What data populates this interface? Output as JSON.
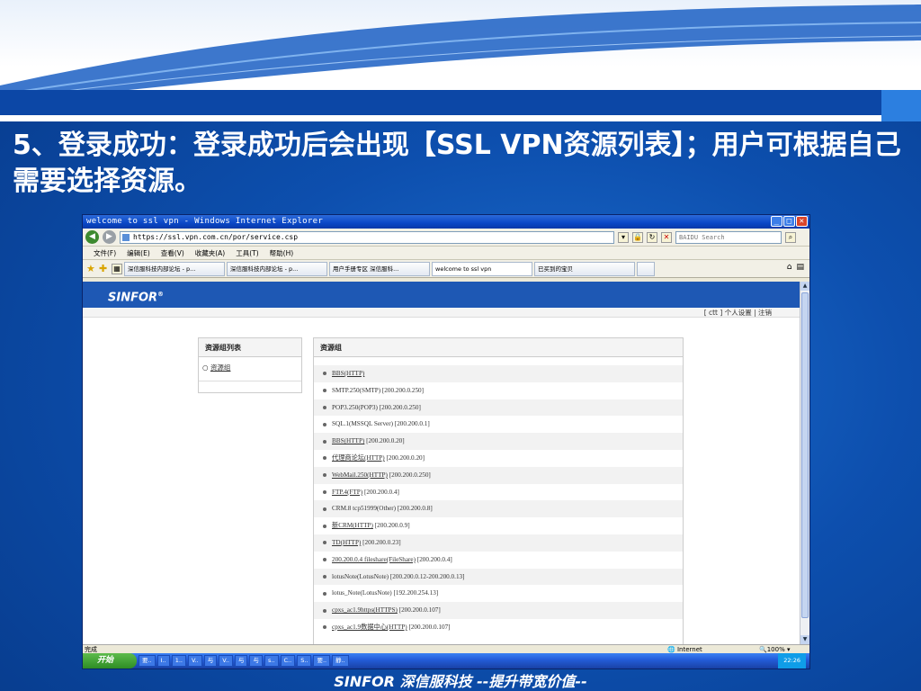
{
  "slide": {
    "title": "5、登录成功：登录成功后会出现【SSL VPN资源列表】；用户可根据自己需要选择资源。",
    "footer": "SINFOR 深信服科技  --提升带宽价值--"
  },
  "window": {
    "title": "welcome to ssl vpn - Windows Internet Explorer",
    "address": "https://ssl.vpn.com.cn/por/service.csp",
    "search_placeholder": "BAIDU Search",
    "menu": [
      "文件(F)",
      "编辑(E)",
      "查看(V)",
      "收藏夹(A)",
      "工具(T)",
      "帮助(H)"
    ],
    "tabs": [
      "深信服科技内部论坛 - p...",
      "深信服科技内部论坛 - p...",
      "用户手册专区 深信服科...",
      "welcome to ssl vpn",
      "已买到的宝贝"
    ],
    "status_left": "完成",
    "status_zone": "Internet",
    "status_zoom": "100%"
  },
  "page": {
    "brand": "SINFOR",
    "brand_mark": "®",
    "top_links": "[ ctt ]  个人设置 | 注销",
    "group_panel_title": "资源组列表",
    "group_item": "资源组",
    "resource_panel_title": "资源组",
    "resources": [
      {
        "link": "BBS(HTTP)",
        "rest": ""
      },
      {
        "link": "",
        "rest": "SMTP.250(SMTP) [200.200.0.250]"
      },
      {
        "link": "",
        "rest": "POP3.250(POP3) [200.200.0.250]"
      },
      {
        "link": "",
        "rest": "SQL.1(MSSQL Server) [200.200.0.1]"
      },
      {
        "link": "BBS(HTTP)",
        "rest": " [200.200.0.20]"
      },
      {
        "link": "代理商论坛(HTTP)",
        "rest": " [200.200.0.20]"
      },
      {
        "link": "WebMail.250(HTTP)",
        "rest": " [200.200.0.250]"
      },
      {
        "link": "FTP.4(FTP)",
        "rest": " [200.200.0.4]"
      },
      {
        "link": "",
        "rest": "CRM.8 tcp51999(Other) [200.200.0.8]"
      },
      {
        "link": "新CRM(HTTP)",
        "rest": " [200.200.0.9]"
      },
      {
        "link": "TD(HTTP)",
        "rest": " [200.200.0.23]"
      },
      {
        "link": "200.200.0.4 fileshare(FileShare)",
        "rest": " [200.200.0.4]"
      },
      {
        "link": "",
        "rest": "lotusNote(LotusNote) [200.200.0.12-200.200.0.13]"
      },
      {
        "link": "",
        "rest": "lotus_Note(LotusNote) [192.200.254.13]"
      },
      {
        "link": "cpxs_ac1.9https(HTTPS)",
        "rest": " [200.200.0.107]"
      },
      {
        "link": "cpxs_ac1.9数据中心(HTTP)",
        "rest": " [200.200.0.107]"
      }
    ]
  },
  "taskbar": {
    "start": "开始",
    "buttons": [
      "要..",
      "I..",
      "1..",
      "V..",
      "与",
      "V..",
      "与",
      "与",
      "s..",
      "C..",
      "S..",
      "要..",
      "静.."
    ],
    "clock": "22:26"
  }
}
